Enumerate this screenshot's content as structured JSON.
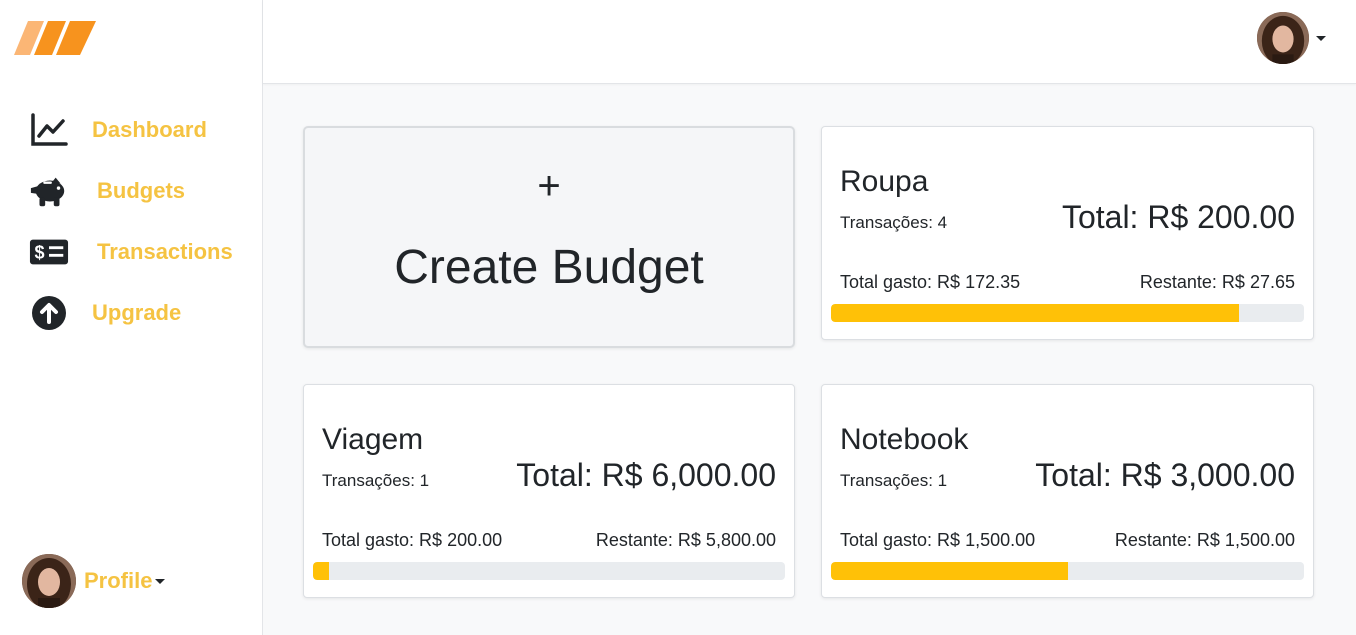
{
  "sidebar": {
    "logo": "brand-logo",
    "items": [
      {
        "label": "Dashboard",
        "icon": "chart-line-icon"
      },
      {
        "label": "Budgets",
        "icon": "piggy-bank-icon"
      },
      {
        "label": "Transactions",
        "icon": "money-check-icon"
      },
      {
        "label": "Upgrade",
        "icon": "arrow-up-circle-icon"
      }
    ],
    "profile_label": "Profile"
  },
  "main": {
    "create_budget": {
      "plus": "+",
      "label": "Create Budget"
    },
    "budgets": [
      {
        "name": "Roupa",
        "transactions": "Transações: 4",
        "total": "Total: R$ 200.00",
        "spent": "Total gasto: R$ 172.35",
        "remaining": "Restante: R$ 27.65",
        "progress": 0.8618
      },
      {
        "name": "Viagem",
        "transactions": "Transações: 1",
        "total": "Total: R$ 6,000.00",
        "spent": "Total gasto: R$ 200.00",
        "remaining": "Restante: R$ 5,800.00",
        "progress": 0.0333
      },
      {
        "name": "Notebook",
        "transactions": "Transações: 1",
        "total": "Total: R$ 3,000.00",
        "spent": "Total gasto: R$ 1,500.00",
        "remaining": "Restante: R$ 1,500.00",
        "progress": 0.5
      }
    ]
  },
  "colors": {
    "accent": "#f5c342",
    "progress": "#ffc107",
    "logo_light": "#fbb675",
    "logo_dark": "#f7931e"
  }
}
